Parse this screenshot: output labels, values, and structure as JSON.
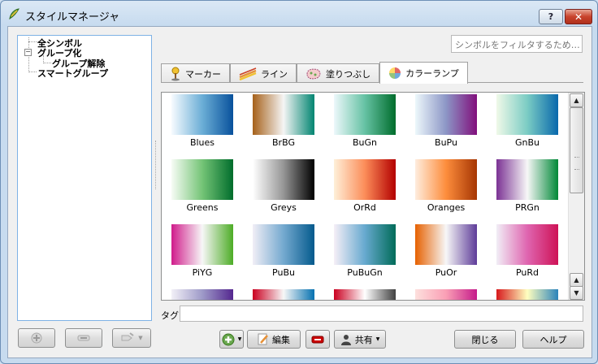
{
  "window": {
    "title": "スタイルマネージャ",
    "help_button": "?",
    "close_button": "✕"
  },
  "tree": {
    "items": [
      {
        "label": "全シンボル"
      },
      {
        "label": "グループ化",
        "expander": "−"
      },
      {
        "label": "グループ解除"
      },
      {
        "label": "スマートグループ"
      }
    ]
  },
  "filter": {
    "placeholder": "シンボルをフィルタするため…"
  },
  "tabs": [
    {
      "label": "マーカー",
      "icon": "marker-icon"
    },
    {
      "label": "ライン",
      "icon": "line-icon"
    },
    {
      "label": "塗りつぶし",
      "icon": "fill-icon"
    },
    {
      "label": "カラーランプ",
      "icon": "color-ramp-icon",
      "active": true
    }
  ],
  "ramps": [
    {
      "name": "Blues",
      "colors": [
        "#f7fbff",
        "#6baed6",
        "#08519c"
      ]
    },
    {
      "name": "BrBG",
      "colors": [
        "#a6611a",
        "#f5f5f5",
        "#018571"
      ]
    },
    {
      "name": "BuGn",
      "colors": [
        "#edf8fb",
        "#66c2a4",
        "#006d2c"
      ]
    },
    {
      "name": "BuPu",
      "colors": [
        "#edf8fb",
        "#8c96c6",
        "#810f7c"
      ]
    },
    {
      "name": "GnBu",
      "colors": [
        "#f0f9e8",
        "#7bccc4",
        "#0868ac"
      ]
    },
    {
      "name": "Greens",
      "colors": [
        "#f7fcf5",
        "#74c476",
        "#006d2c"
      ]
    },
    {
      "name": "Greys",
      "colors": [
        "#ffffff",
        "#969696",
        "#000000"
      ]
    },
    {
      "name": "OrRd",
      "colors": [
        "#fef0d9",
        "#fc8d59",
        "#b30000"
      ]
    },
    {
      "name": "Oranges",
      "colors": [
        "#feedde",
        "#fd8d3c",
        "#a63603"
      ]
    },
    {
      "name": "PRGn",
      "colors": [
        "#7b3294",
        "#f7f7f7",
        "#008837"
      ]
    },
    {
      "name": "PiYG",
      "colors": [
        "#d01c8b",
        "#f7f7f7",
        "#4dac26"
      ]
    },
    {
      "name": "PuBu",
      "colors": [
        "#f1eef6",
        "#74a9cf",
        "#045a8d"
      ]
    },
    {
      "name": "PuBuGn",
      "colors": [
        "#f6eff7",
        "#67a9cf",
        "#016c59"
      ]
    },
    {
      "name": "PuOr",
      "colors": [
        "#e66101",
        "#f7f7f7",
        "#5e3c99"
      ]
    },
    {
      "name": "PuRd",
      "colors": [
        "#f1eef6",
        "#df65b0",
        "#ce1256"
      ]
    },
    {
      "name": "",
      "colors": [
        "#f2f0f7",
        "#9e9ac8",
        "#54278f"
      ]
    },
    {
      "name": "",
      "colors": [
        "#ca0020",
        "#f7f7f7",
        "#0571b0"
      ]
    },
    {
      "name": "",
      "colors": [
        "#ca0020",
        "#ffffff",
        "#404040"
      ]
    },
    {
      "name": "",
      "colors": [
        "#fde0dd",
        "#fa9fb5",
        "#c51b8a"
      ]
    },
    {
      "name": "",
      "colors": [
        "#d7191c",
        "#ffffbf",
        "#2b83ba"
      ]
    }
  ],
  "tag": {
    "label": "タグ",
    "value": ""
  },
  "buttons": {
    "edit": "編集",
    "share": "共有",
    "close": "閉じる",
    "help": "ヘルプ"
  }
}
